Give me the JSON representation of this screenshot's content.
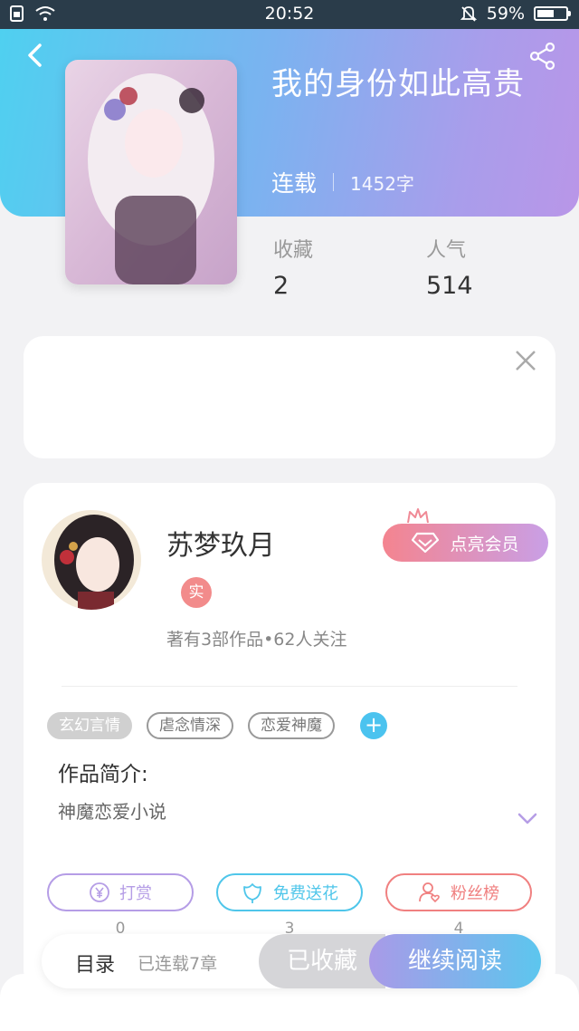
{
  "status_bar": {
    "time": "20:52",
    "battery": "59%",
    "battery_level": 0.59
  },
  "book": {
    "title": "我的身份如此高贵",
    "status": "连载",
    "word_count": "1452字",
    "stats": [
      {
        "label": "收藏",
        "value": "2"
      },
      {
        "label": "人气",
        "value": "514"
      }
    ]
  },
  "author": {
    "name": "苏梦玖月",
    "badge": "实",
    "summary": "著有3部作品•62人关注",
    "vip_button": "点亮会员"
  },
  "tags": [
    {
      "label": "玄幻言情",
      "style": "filled"
    },
    {
      "label": "虐念情深",
      "style": "outline"
    },
    {
      "label": "恋爱神魔",
      "style": "outline"
    }
  ],
  "intro": {
    "title": "作品简介:",
    "text": "神魔恋爱小说"
  },
  "actions": [
    {
      "label": "打赏",
      "count": "0",
      "color": "#b59de6",
      "icon": "yen-icon"
    },
    {
      "label": "免费送花",
      "count": "3",
      "color": "#4fc6ea",
      "icon": "flower-icon"
    },
    {
      "label": "粉丝榜",
      "count": "4",
      "color": "#f08080",
      "icon": "fan-icon"
    }
  ],
  "bottom_bar": {
    "toc": "目录",
    "chapters": "已连载7章",
    "collected": "已收藏",
    "read": "继续阅读"
  },
  "colors": {
    "header_start": "#4fd0f0",
    "header_end": "#b996e8",
    "accent_blue": "#4bc3ef"
  }
}
